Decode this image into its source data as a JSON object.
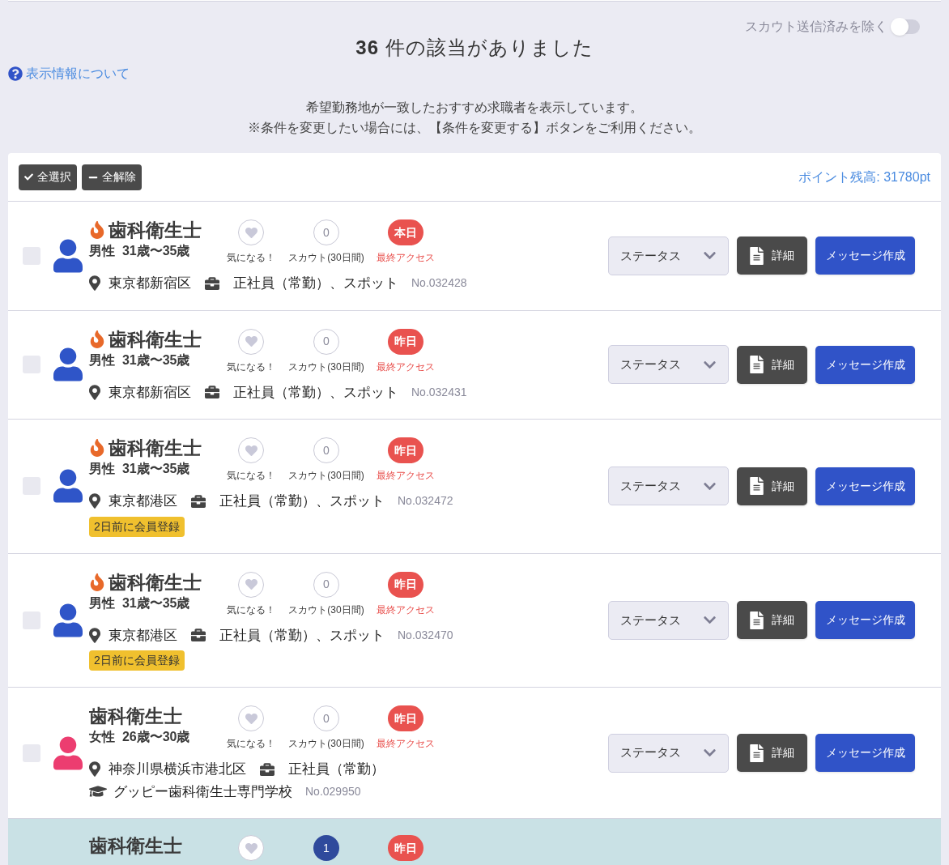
{
  "scout_filter": {
    "label": "スカウト送信済みを除く",
    "on": false
  },
  "result_title": "**36** 件の該当がありました",
  "help_link": "表示情報について",
  "notes": [
    "希望勤務地が一致したおすすめ求職者を表示しています。",
    "※条件を変更したい場合には、【条件を変更する】ボタンをご利用ください。"
  ],
  "toolbar": {
    "select_all": "全選択",
    "deselect_all": "全解除",
    "points": "ポイント残高: 31780pt"
  },
  "rows": [
    {
      "checked": false,
      "color": "#2f55c8",
      "hot": true,
      "title": "歯科衛生士",
      "profile": "男性  31歳〜35歳",
      "favorite_label": "気になる！",
      "scout_count": "0",
      "scout_label": "スカウト(30日間)",
      "scouted": false,
      "access": "本日",
      "access_label": "最終アクセス",
      "location": "東京都新宿区",
      "employment": "正社員（常勤）、スポット",
      "number": "No.032428",
      "status_placeholder": "ステータス",
      "detail": "詳細",
      "message": "メッセージ作成"
    },
    {
      "checked": false,
      "color": "#2f55c8",
      "hot": true,
      "title": "歯科衛生士",
      "profile": "男性  31歳〜35歳",
      "favorite_label": "気になる！",
      "scout_count": "0",
      "scout_label": "スカウト(30日間)",
      "scouted": false,
      "access": "昨日",
      "access_label": "最終アクセス",
      "location": "東京都新宿区",
      "employment": "正社員（常勤）、スポット",
      "number": "No.032431",
      "status_placeholder": "ステータス",
      "detail": "詳細",
      "message": "メッセージ作成"
    },
    {
      "checked": false,
      "color": "#2f55c8",
      "hot": true,
      "title": "歯科衛生士",
      "profile": "男性  31歳〜35歳",
      "favorite_label": "気になる！",
      "scout_count": "0",
      "scout_label": "スカウト(30日間)",
      "scouted": false,
      "access": "昨日",
      "access_label": "最終アクセス",
      "location": "東京都港区",
      "employment": "正社員（常勤）、スポット",
      "number": "No.032472",
      "registered": "2日前に会員登録",
      "status_placeholder": "ステータス",
      "detail": "詳細",
      "message": "メッセージ作成"
    },
    {
      "checked": false,
      "color": "#2f55c8",
      "hot": true,
      "title": "歯科衛生士",
      "profile": "男性  31歳〜35歳",
      "favorite_label": "気になる！",
      "scout_count": "0",
      "scout_label": "スカウト(30日間)",
      "scouted": false,
      "access": "昨日",
      "access_label": "最終アクセス",
      "location": "東京都港区",
      "employment": "正社員（常勤）、スポット",
      "number": "No.032470",
      "registered": "2日前に会員登録",
      "status_placeholder": "ステータス",
      "detail": "詳細",
      "message": "メッセージ作成"
    },
    {
      "checked": false,
      "color": "#ec3d70",
      "hot": false,
      "title": "歯科衛生士",
      "profile": "女性  26歳〜30歳",
      "favorite_label": "気になる！",
      "scout_count": "0",
      "scout_label": "スカウト(30日間)",
      "scouted": false,
      "access": "昨日",
      "access_label": "最終アクセス",
      "location": "神奈川県横浜市港北区",
      "employment": "正社員（常勤）",
      "school": "グッピー歯科衛生士専門学校",
      "number": "No.029950",
      "status_placeholder": "ステータス",
      "detail": "詳細",
      "message": "メッセージ作成"
    },
    {
      "hot": false,
      "title": "歯科衛生士",
      "scout_count": "1",
      "scouted": true,
      "access": "昨日"
    }
  ]
}
